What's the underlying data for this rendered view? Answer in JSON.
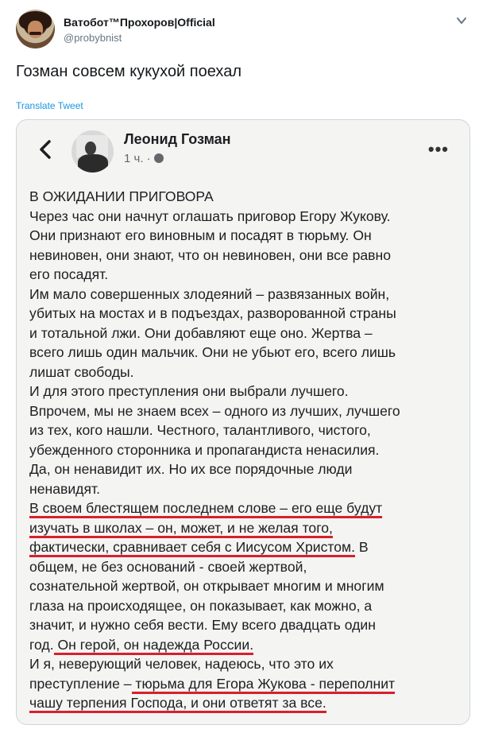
{
  "tweet": {
    "author_name": "Ватобот™Прохоров|Official",
    "author_handle": "@probybnist",
    "text": "Гозман совсем кукухой поехал",
    "translate_label": "Translate Tweet",
    "icons": {
      "caret": "chevron-down-icon"
    }
  },
  "embedded_post": {
    "author_name": "Леонид Гозман",
    "time": "1 ч. ·",
    "more_label": "•••",
    "icons": {
      "back": "chevron-left-icon",
      "privacy": "globe-icon",
      "more": "more-options-icon"
    },
    "accent_color": "#d6202d",
    "lines": [
      {
        "segments": [
          {
            "text": "В ОЖИДАНИИ ПРИГОВОРА"
          }
        ]
      },
      {
        "segments": [
          {
            "text": "Через час они начнут оглашать приговор Егору Жукову."
          }
        ]
      },
      {
        "segments": [
          {
            "text": "Они признают его виновным и посадят в тюрьму. Он"
          }
        ]
      },
      {
        "segments": [
          {
            "text": "невиновен, они знают, что он невиновен, они все равно"
          }
        ]
      },
      {
        "segments": [
          {
            "text": "его посадят."
          }
        ]
      },
      {
        "segments": [
          {
            "text": "Им мало совершенных злодеяний – развязанных войн,"
          }
        ]
      },
      {
        "segments": [
          {
            "text": "убитых на мостах и в подъездах,  разворованной страны"
          }
        ]
      },
      {
        "segments": [
          {
            "text": "и тотальной лжи. Они добавляют еще оно. Жертва –"
          }
        ]
      },
      {
        "segments": [
          {
            "text": "всего лишь один мальчик. Они не убьют его, всего лишь"
          }
        ]
      },
      {
        "segments": [
          {
            "text": "лишат свободы."
          }
        ]
      },
      {
        "segments": [
          {
            "text": "И для этого преступления они выбрали лучшего."
          }
        ]
      },
      {
        "segments": [
          {
            "text": "Впрочем, мы не знаем всех – одного из лучших, лучшего"
          }
        ]
      },
      {
        "segments": [
          {
            "text": "из тех, кого нашли. Честного, талантливого, чистого,"
          }
        ]
      },
      {
        "segments": [
          {
            "text": "убежденного сторонника и пропагандиста ненасилия."
          }
        ]
      },
      {
        "segments": [
          {
            "text": "Да, он ненавидит их. Но их все порядочные люди"
          }
        ]
      },
      {
        "segments": [
          {
            "text": "ненавидят."
          }
        ]
      },
      {
        "segments": [
          {
            "text": "В своем блестящем последнем слове – его еще будут",
            "hl": true
          }
        ]
      },
      {
        "segments": [
          {
            "text": "изучать в школах – он, может, и не желая того,",
            "hl": true
          }
        ]
      },
      {
        "segments": [
          {
            "text": "фактически, сравнивает себя с Иисусом Христом.",
            "hl": true
          },
          {
            "text": "  В"
          }
        ]
      },
      {
        "segments": [
          {
            "text": "общем, не без оснований - своей жертвой,"
          }
        ]
      },
      {
        "segments": [
          {
            "text": "сознательной жертвой, он открывает многим и многим"
          }
        ]
      },
      {
        "segments": [
          {
            "text": "глаза на происходящее, он показывает, как можно, а"
          }
        ]
      },
      {
        "segments": [
          {
            "text": "значит, и нужно себя вести. Ему всего двадцать один"
          }
        ]
      },
      {
        "segments": [
          {
            "text": "год."
          },
          {
            "text": " Он герой, он надежда России.",
            "hl": true
          }
        ]
      },
      {
        "segments": [
          {
            "text": "И я, неверующий человек, надеюсь, что это их"
          }
        ]
      },
      {
        "segments": [
          {
            "text": "преступление –"
          },
          {
            "text": " тюрьма для Егора Жукова - переполнит",
            "hl": true
          }
        ]
      },
      {
        "segments": [
          {
            "text": "чашу терпения Господа, и они ответят за все.",
            "hl": true
          }
        ]
      }
    ]
  }
}
